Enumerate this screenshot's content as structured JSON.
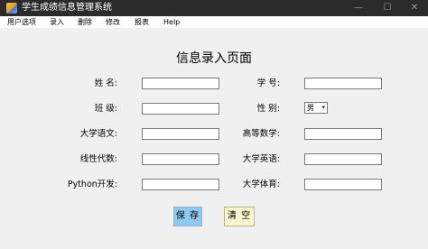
{
  "window": {
    "title": "学生成绩信息管理系统",
    "controls": {
      "minimize": "—",
      "maximize": "☐",
      "close": "✕"
    }
  },
  "menu": {
    "items": [
      "用户选项",
      "录入",
      "删除",
      "修改",
      "报表",
      "Help"
    ]
  },
  "form": {
    "title": "信息录入页面",
    "name_label": "姓  名:",
    "student_id_label": "学  号:",
    "class_label": "班  级:",
    "gender_label": "性  别:",
    "gender_value": "男",
    "chinese_label": "大学语文:",
    "math_label": "高等数学:",
    "linear_algebra_label": "线性代数:",
    "english_label": "大学英语:",
    "python_label": "Python开发:",
    "pe_label": "大学体育:",
    "values": {
      "name": "",
      "student_id": "",
      "class": "",
      "chinese": "",
      "math": "",
      "linear_algebra": "",
      "english": "",
      "python": "",
      "pe": ""
    }
  },
  "buttons": {
    "save": "保 存",
    "clear": "清 空"
  },
  "colors": {
    "titlebar": "#2b2b2b",
    "save_button": "#8ec8ef",
    "clear_button": "#fbf5cf"
  }
}
